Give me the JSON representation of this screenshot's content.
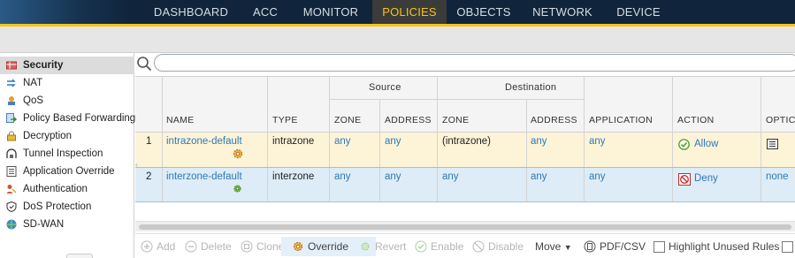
{
  "nav": {
    "tabs": [
      "DASHBOARD",
      "ACC",
      "MONITOR",
      "POLICIES",
      "OBJECTS",
      "NETWORK",
      "DEVICE"
    ],
    "active": "POLICIES"
  },
  "sidebar": {
    "items": [
      {
        "label": "Security",
        "icon": "security-rulebase-icon"
      },
      {
        "label": "NAT",
        "icon": "nat-icon"
      },
      {
        "label": "QoS",
        "icon": "qos-icon"
      },
      {
        "label": "Policy Based Forwarding",
        "icon": "pbf-icon"
      },
      {
        "label": "Decryption",
        "icon": "lock-icon"
      },
      {
        "label": "Tunnel Inspection",
        "icon": "tunnel-icon"
      },
      {
        "label": "Application Override",
        "icon": "app-override-icon"
      },
      {
        "label": "Authentication",
        "icon": "user-key-icon"
      },
      {
        "label": "DoS Protection",
        "icon": "shield-icon"
      },
      {
        "label": "SD-WAN",
        "icon": "sdwan-icon"
      }
    ]
  },
  "search": {
    "placeholder": "",
    "value": ""
  },
  "table": {
    "group_headers": {
      "source": "Source",
      "destination": "Destination"
    },
    "columns": {
      "name": "NAME",
      "type": "TYPE",
      "src_zone": "ZONE",
      "src_address": "ADDRESS",
      "dst_zone": "ZONE",
      "dst_address": "ADDRESS",
      "application": "APPLICATION",
      "action": "ACTION",
      "options": "OPTIC"
    },
    "rows": [
      {
        "num": "1",
        "name": "intrazone-default",
        "type": "intrazone",
        "src_zone": "any",
        "src_address": "any",
        "dst_zone": "(intrazone)",
        "dst_address": "any",
        "application": "any",
        "action": "Allow",
        "options": ""
      },
      {
        "num": "2",
        "name": "interzone-default",
        "type": "interzone",
        "src_zone": "any",
        "src_address": "any",
        "dst_zone": "any",
        "dst_address": "any",
        "application": "any",
        "action": "Deny",
        "options": "none"
      }
    ]
  },
  "toolbar": {
    "add": "Add",
    "delete": "Delete",
    "clone": "Clone",
    "override": "Override",
    "revert": "Revert",
    "enable": "Enable",
    "disable": "Disable",
    "move": "Move",
    "pdf_csv": "PDF/CSV",
    "highlight": "Highlight Unused Rules"
  },
  "colors": {
    "nav_bg": "#10243b",
    "accent": "#f5c518",
    "link": "#2f78b7",
    "allow": "#3a9a3a",
    "deny": "#c0282e"
  }
}
